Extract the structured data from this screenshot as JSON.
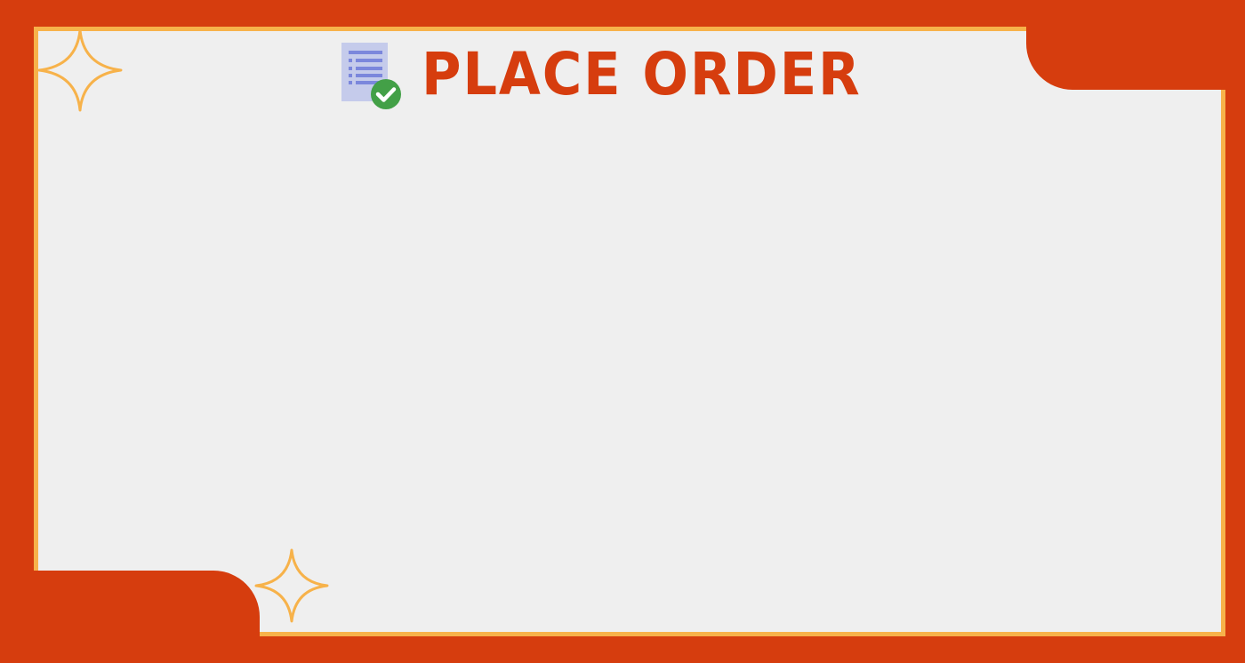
{
  "header": {
    "title": "PLACE ORDER",
    "icon": "order-checklist-icon",
    "badge_icon": "check-circle-icon"
  },
  "decorations": {
    "sparkle_icon": "four-point-star-icon"
  },
  "colors": {
    "frame": "#D63D0E",
    "panel": "#EFEFEF",
    "border": "#F7B24A",
    "sparkle": "#F7B24A",
    "title": "#D63D0E",
    "document": "#C5CBEB",
    "document_lines": "#7B87DC",
    "check_badge": "#43A047"
  }
}
